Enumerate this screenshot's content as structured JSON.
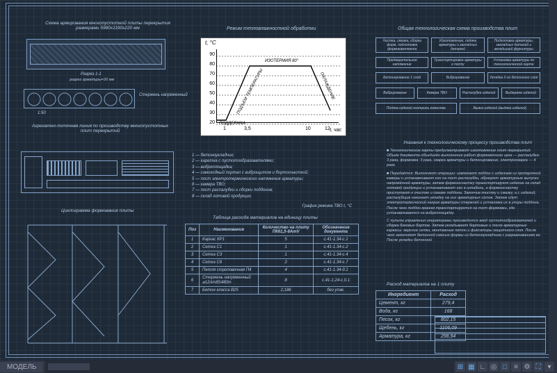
{
  "titles": {
    "top_left": "Схема армирования многопустотной плиты перекрытия размерами 5980х1190х220 мм",
    "thermal": "Режим тепловлажностной обработки",
    "flow": "Общая технологическая схема производства плит",
    "aggregate": "Агрегатно-поточная линия по производству многопустотных плит перекрытий",
    "cycle": "Циклограмма формования плиты",
    "table_main": "Таблица расхода материалов на единицу плиты",
    "mat_table": "Расход материалов на 1 плиту",
    "notes": "Указания к технологическому процессу производства плит"
  },
  "chart_data": {
    "type": "line",
    "title": "",
    "ylabel": "t, °C",
    "xlabel": "t, час",
    "x": [
      0,
      1,
      3.5,
      10,
      12
    ],
    "y": [
      20,
      20,
      80,
      80,
      30
    ],
    "yticks": [
      20,
      30,
      40,
      50,
      60,
      70,
      80,
      90
    ],
    "xticks": [
      1,
      3.5,
      10,
      12
    ],
    "xlim": [
      0,
      13
    ],
    "ylim": [
      15,
      95
    ],
    "annotations": [
      "ПОДДЕРЖКА",
      "ПОДЪЕМ ТЕМПЕРАТУРЫ",
      "ИЗОТЕРМИЯ 80°",
      "ОХЛАЖДЕНИЕ"
    ]
  },
  "legend": {
    "items": [
      "1 — бетоноукладчик;",
      "2 — каретка с пустотообразователями;",
      "3 — виброплощадка;",
      "4 — самоходный портал с виброщитом и бортоснасткой;",
      "5 — пост электротермического натяжения арматуры;",
      "6 — камера ТВО;",
      "7 — пост распалубки и сборки поддонов;",
      "8 — склад готовой продукции"
    ],
    "tail": "График режима ТВО   t, °C"
  },
  "flow_rows": [
    [
      "Чистка, смазка, сборка форм, подготовка формокамплекта",
      "Изготовление, подача арматуры и закладных деталей",
      "Подготовка арматуры, закладных деталей и вкладышей фурнитуры"
    ],
    [
      "Предварительное натяжение",
      "Транспортировка арматуры к посту",
      "Установка арматуры по технологической карте"
    ],
    [
      "Бетонирование 1 слой",
      "Вибрирование",
      "Укладка 2-го бетонного слоя"
    ],
    [
      "Вибрирование",
      "Камера ТВО",
      "Распалубка изделий",
      "Выдержка изделий"
    ],
    [
      "Подача изделий контроль качества",
      "Вывоз изделий (выдача изделий)"
    ]
  ],
  "table_main": {
    "headers": [
      "Поз",
      "Наименование",
      "Количество на плиту ПК61,5-8АтV",
      "Обозначение документа"
    ],
    "rows": [
      [
        "1",
        "Каркас КР1",
        "5",
        "с.41-1.34-с.1"
      ],
      [
        "2",
        "Сетка С1",
        "1",
        "с.41-1.34-с.2"
      ],
      [
        "3",
        "Сетка С3",
        "1",
        "с.41-1.34-с.4"
      ],
      [
        "4",
        "Сетка С6",
        "2",
        "с.41-1.34-с.7"
      ],
      [
        "5",
        "Петля строповочная П4",
        "4",
        "с.41-1.34-д.1"
      ],
      [
        "6",
        "Стержень напряженный ⌀12Ат8S480m",
        "8",
        "с.41-1.24-с.0.1"
      ],
      [
        "7",
        "Бетон класса В25",
        "2,186",
        "без упак."
      ]
    ]
  },
  "table_mat": {
    "headers": [
      "Ингредиент",
      "Расход"
    ],
    "rows": [
      [
        "Цемент, кг",
        "279,4"
      ],
      [
        "Вода, кг",
        "168"
      ],
      [
        "Песок, кг",
        "802,15"
      ],
      [
        "Щебень, кг",
        "1106,09"
      ],
      [
        "Арматура, кг",
        "298,94"
      ]
    ]
  },
  "labels": {
    "razrez": "Разрез 1-1",
    "razrez_sub": "разрез арматуры=20 мм",
    "sterj": "Стержень напряженный",
    "m1_50": "1:50"
  },
  "notes_text": [
    "Технологические карты предусматривают изготовление плит перекрытий. Объем документа объединён выполнение работ формовочного цеха — распалубка: 3 раза, формовка: 3 раза, сварка арматуры и бетонирование, электросварка — 4 раза.",
    "Передаётся: Выполняют операции: извлекают поддон с изделием из пропарочной камеры и устанавливают его на пост распалубки, образуют арматурные выпуски напряжённой арматуры, затем формооснастку транспортируют изделие на склад готовой продукции и устанавливают его в штабель, а формооснастку приступают к очистке и смазке поддона. Закончив очистку и смазку, а с изделий, распалубщик начинает укладку на них арматурных сеток. Затем идут электротермический нагрев арматуры стержней и установка их в упоры поддона. После чего поддон краном транспортируется на пост формовки, где устанавливается на виброплощадку.",
    "С пульта управления операторами производится ввод пустотообразователей и сборка боковых бортов. Затем укладывают бортовые и после арматурные каркасы: верхние сетки, монтажные петли и фиксаторы защитного слоя. После чего заполняют бетонной смесью формы из бетоноукладчика с разравниванием ее. После укладки бетонной"
  ],
  "statusbar": {
    "btn1": "МОДЕЛЬ",
    "btn2": ""
  }
}
